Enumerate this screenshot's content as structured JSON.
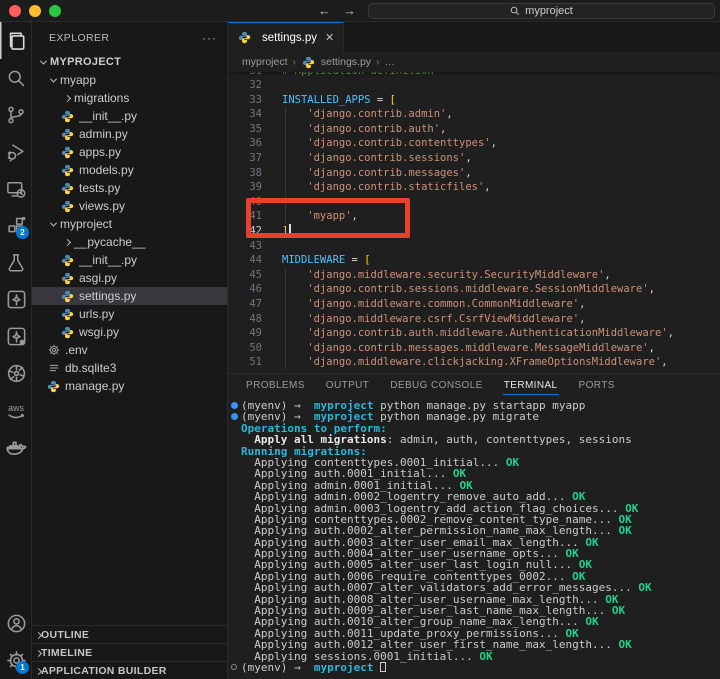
{
  "titlebar": {
    "search_text": "myproject"
  },
  "activity_bar": {
    "top": [
      {
        "name": "explorer-icon",
        "active": true
      },
      {
        "name": "search-icon"
      },
      {
        "name": "source-control-icon"
      },
      {
        "name": "run-debug-icon"
      },
      {
        "name": "remote-explorer-icon"
      },
      {
        "name": "extensions-icon",
        "badge": "2"
      },
      {
        "name": "testing-icon"
      },
      {
        "name": "extension-bird-icon"
      },
      {
        "name": "extension-bird2-icon"
      },
      {
        "name": "kubernetes-icon"
      },
      {
        "name": "aws-icon"
      },
      {
        "name": "docker-icon"
      }
    ],
    "bottom": [
      {
        "name": "accounts-icon"
      },
      {
        "name": "settings-gear-icon",
        "badge": "1"
      }
    ]
  },
  "explorer": {
    "title": "EXPLORER",
    "root_label": "MYPROJECT",
    "tree": [
      {
        "label": "myapp",
        "chevron": "down",
        "level": 1
      },
      {
        "label": "migrations",
        "chevron": "right",
        "level": 2
      },
      {
        "label": "__init__.py",
        "icon": "python",
        "level": 2
      },
      {
        "label": "admin.py",
        "icon": "python",
        "level": 2
      },
      {
        "label": "apps.py",
        "icon": "python",
        "level": 2
      },
      {
        "label": "models.py",
        "icon": "python",
        "level": 2
      },
      {
        "label": "tests.py",
        "icon": "python",
        "level": 2
      },
      {
        "label": "views.py",
        "icon": "python",
        "level": 2
      },
      {
        "label": "myproject",
        "chevron": "down",
        "level": 1
      },
      {
        "label": "__pycache__",
        "chevron": "right",
        "level": 2
      },
      {
        "label": "__init__.py",
        "icon": "python",
        "level": 2
      },
      {
        "label": "asgi.py",
        "icon": "python",
        "level": 2
      },
      {
        "label": "settings.py",
        "icon": "python",
        "level": 2,
        "selected": true
      },
      {
        "label": "urls.py",
        "icon": "python",
        "level": 2
      },
      {
        "label": "wsgi.py",
        "icon": "python",
        "level": 2
      },
      {
        "label": ".env",
        "icon": "gear",
        "level": 1
      },
      {
        "label": "db.sqlite3",
        "icon": "database",
        "level": 1
      },
      {
        "label": "manage.py",
        "icon": "python",
        "level": 1
      }
    ],
    "sections": [
      "OUTLINE",
      "TIMELINE",
      "APPLICATION BUILDER"
    ]
  },
  "editor": {
    "tab_label": "settings.py",
    "close_glyph": "✕",
    "breadcrumb": {
      "items": [
        "myproject",
        "settings.py",
        "…"
      ]
    },
    "code_lines": [
      {
        "n": 31,
        "clip": true,
        "s": [
          [
            "comment",
            "# Application definition"
          ]
        ]
      },
      {
        "n": 32,
        "s": []
      },
      {
        "n": 33,
        "s": [
          [
            "var",
            "INSTALLED_APPS"
          ],
          [
            "plain",
            " = "
          ],
          [
            "bracket",
            "["
          ]
        ]
      },
      {
        "n": 34,
        "s": [
          [
            "str",
            "    'django.contrib.admin'"
          ],
          [
            "plain",
            ","
          ]
        ]
      },
      {
        "n": 35,
        "s": [
          [
            "str",
            "    'django.contrib.auth'"
          ],
          [
            "plain",
            ","
          ]
        ]
      },
      {
        "n": 36,
        "s": [
          [
            "str",
            "    'django.contrib.contenttypes'"
          ],
          [
            "plain",
            ","
          ]
        ]
      },
      {
        "n": 37,
        "s": [
          [
            "str",
            "    'django.contrib.sessions'"
          ],
          [
            "plain",
            ","
          ]
        ]
      },
      {
        "n": 38,
        "s": [
          [
            "str",
            "    'django.contrib.messages'"
          ],
          [
            "plain",
            ","
          ]
        ]
      },
      {
        "n": 39,
        "s": [
          [
            "str",
            "    'django.contrib.staticfiles'"
          ],
          [
            "plain",
            ","
          ]
        ]
      },
      {
        "n": 40,
        "s": []
      },
      {
        "n": 41,
        "s": [
          [
            "str",
            "    'myapp'"
          ],
          [
            "plain",
            ","
          ]
        ]
      },
      {
        "n": 42,
        "active": true,
        "cursor": true,
        "s": [
          [
            "bracket",
            "]"
          ]
        ]
      },
      {
        "n": 43,
        "s": []
      },
      {
        "n": 44,
        "s": [
          [
            "var",
            "MIDDLEWARE"
          ],
          [
            "plain",
            " = "
          ],
          [
            "bracket",
            "["
          ]
        ]
      },
      {
        "n": 45,
        "s": [
          [
            "str",
            "    'django.middleware.security.SecurityMiddleware'"
          ],
          [
            "plain",
            ","
          ]
        ]
      },
      {
        "n": 46,
        "s": [
          [
            "str",
            "    'django.contrib.sessions.middleware.SessionMiddleware'"
          ],
          [
            "plain",
            ","
          ]
        ]
      },
      {
        "n": 47,
        "s": [
          [
            "str",
            "    'django.middleware.common.CommonMiddleware'"
          ],
          [
            "plain",
            ","
          ]
        ]
      },
      {
        "n": 48,
        "s": [
          [
            "str",
            "    'django.middleware.csrf.CsrfViewMiddleware'"
          ],
          [
            "plain",
            ","
          ]
        ]
      },
      {
        "n": 49,
        "s": [
          [
            "str",
            "    'django.contrib.auth.middleware.AuthenticationMiddleware'"
          ],
          [
            "plain",
            ","
          ]
        ]
      },
      {
        "n": 50,
        "s": [
          [
            "str",
            "    'django.contrib.messages.middleware.MessageMiddleware'"
          ],
          [
            "plain",
            ","
          ]
        ]
      },
      {
        "n": 51,
        "s": [
          [
            "str",
            "    'django.middleware.clickjacking.XFrameOptionsMiddleware'"
          ],
          [
            "plain",
            ","
          ]
        ]
      }
    ]
  },
  "annotation": {
    "name": "highlight-rectangle",
    "color": "#e8402a"
  },
  "panel": {
    "tabs": [
      "PROBLEMS",
      "OUTPUT",
      "DEBUG CONSOLE",
      "TERMINAL",
      "PORTS"
    ],
    "active_tab": "TERMINAL",
    "terminal": {
      "prompt_prefix": "(myenv) →  ",
      "prompt_dir": "myproject",
      "command_1": " python manage.py startapp myapp",
      "command_2": " python manage.py migrate",
      "operations_header": "Operations to perform:",
      "apply_bold": "  Apply all migrations",
      "apply_rest": ": admin, auth, contenttypes, sessions",
      "running_header": "Running migrations:",
      "applying_prefix": "  Applying ",
      "ellipsis": "... ",
      "ok_label": "OK",
      "migrations": [
        "contenttypes.0001_initial",
        "auth.0001_initial",
        "admin.0001_initial",
        "admin.0002_logentry_remove_auto_add",
        "admin.0003_logentry_add_action_flag_choices",
        "contenttypes.0002_remove_content_type_name",
        "auth.0002_alter_permission_name_max_length",
        "auth.0003_alter_user_email_max_length",
        "auth.0004_alter_user_username_opts",
        "auth.0005_alter_user_last_login_null",
        "auth.0006_require_contenttypes_0002",
        "auth.0007_alter_validators_add_error_messages",
        "auth.0008_alter_user_username_max_length",
        "auth.0009_alter_user_last_name_max_length",
        "auth.0010_alter_group_name_max_length",
        "auth.0011_update_proxy_permissions",
        "auth.0012_alter_user_first_name_max_length",
        "sessions.0001_initial"
      ]
    }
  },
  "colors": {
    "accent_blue": "#0078d4",
    "annotation_red": "#e8402a",
    "terminal_cyan": "#29b8db",
    "terminal_green": "#23d18b",
    "string_orange": "#ce9178",
    "comment_green": "#6a9955",
    "variable_blue": "#4fc1ff",
    "bracket_gold": "#ffd700"
  }
}
